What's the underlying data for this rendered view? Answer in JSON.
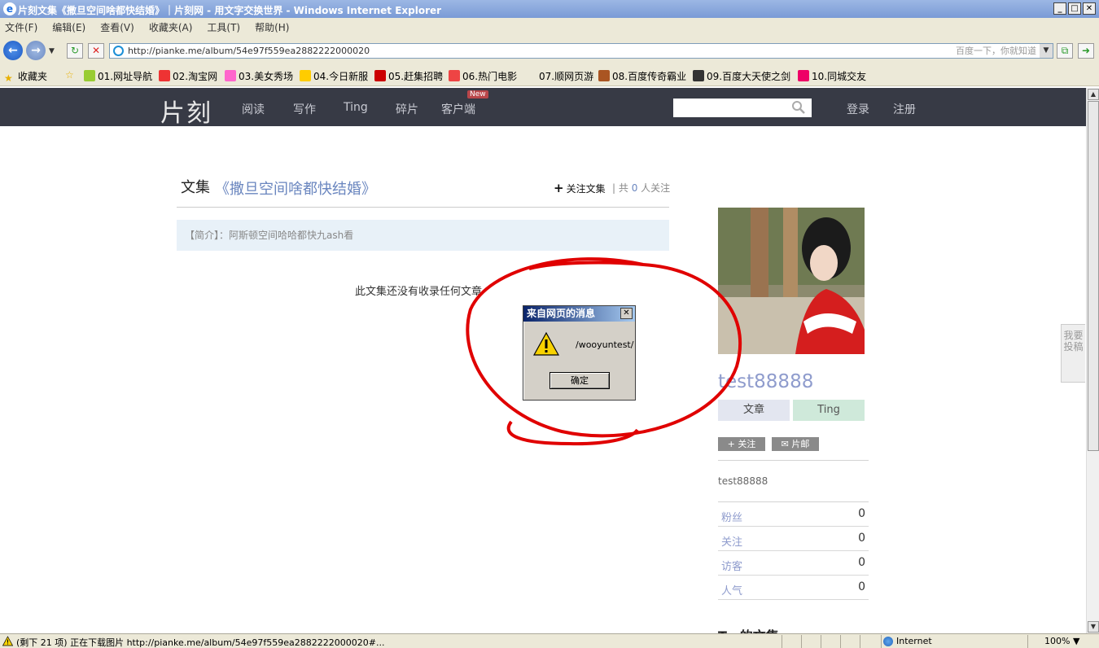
{
  "browser": {
    "title": "片刻文集《撒旦空间啥都快结婚》｜片刻网 - 用文字交换世界 - Windows Internet Explorer",
    "menu": [
      "文件(F)",
      "编辑(E)",
      "查看(V)",
      "收藏夹(A)",
      "工具(T)",
      "帮助(H)"
    ],
    "url": "http://pianke.me/album/54e97f559ea2882222000020",
    "search_hint": "百度一下，你就知道",
    "favorites_label": "收藏夹",
    "favorites": [
      "01.网址导航",
      "02.淘宝网",
      "03.美女秀场",
      "04.今日新服",
      "05.赶集招聘",
      "06.热门电影",
      "07.顺网页游",
      "08.百度传奇霸业",
      "09.百度大天使之剑",
      "10.同城交友"
    ],
    "status_text": "(剩下 21 项) 正在下载图片 http://pianke.me/album/54e97f559ea2882222000020#...",
    "zone": "Internet",
    "zoom": "100%"
  },
  "site": {
    "logo": "片刻",
    "nav": [
      "阅读",
      "写作",
      "Ting",
      "碎片",
      "客户端"
    ],
    "new_badge": "New",
    "login": "登录",
    "register": "注册",
    "submit_tab": "我要投稿"
  },
  "album": {
    "label": "文集",
    "title": "《撒旦空间啥都快结婚》",
    "follow_label": "关注文集",
    "follower_prefix": "共",
    "follower_count": "0",
    "follower_suffix": "人关注",
    "intro": "【简介】：阿斯顿空间哈哈都快九ash看",
    "empty_message": "此文集还没有收录任何文章"
  },
  "profile": {
    "username": "test88888",
    "tabs": [
      "文章",
      "Ting"
    ],
    "follow_button": "关注",
    "mail_button": "片邮",
    "description": "test88888",
    "stats": [
      {
        "label": "粉丝",
        "value": "0"
      },
      {
        "label": "关注",
        "value": "0"
      },
      {
        "label": "访客",
        "value": "0"
      },
      {
        "label": "人气",
        "value": "0"
      }
    ],
    "more_title": "T...的文集"
  },
  "dialog": {
    "title": "来自网页的消息",
    "message": "/wooyuntest/",
    "ok": "确定"
  },
  "colors": {
    "header_bg": "#373a45",
    "link_blue": "#6a86bf",
    "username": "#8f9ccd",
    "annotation_red": "#e00000"
  }
}
